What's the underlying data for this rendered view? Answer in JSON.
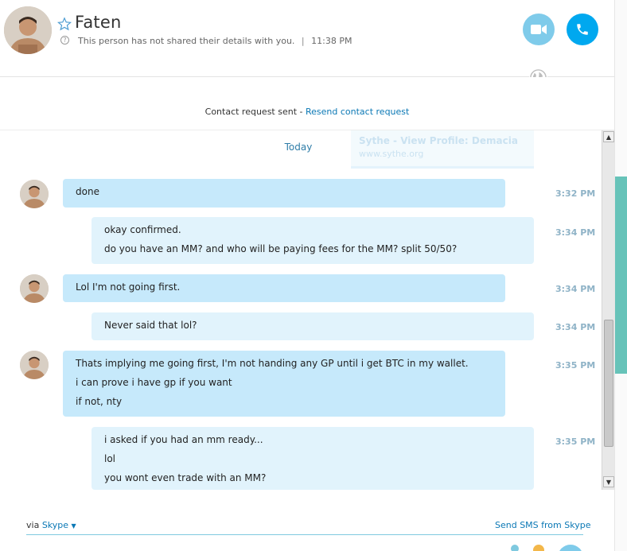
{
  "header": {
    "contact_name": "Faten",
    "subtitle": "This person has not shared their details with you.",
    "separator": "|",
    "time": "11:38 PM"
  },
  "request": {
    "text": "Contact request sent - ",
    "link": "Resend contact request"
  },
  "chat": {
    "ghost_line_1": "Sythe - View Profile: Demacia",
    "ghost_line_2": "www.sythe.org",
    "date_divider": "Today",
    "messages": [
      {
        "direction": "in",
        "time": "3:32 PM",
        "lines": [
          "done"
        ]
      },
      {
        "direction": "out",
        "time": "3:34 PM",
        "lines": [
          "okay confirmed.",
          "do you have an MM? and who will be paying fees for the MM? split 50/50?"
        ]
      },
      {
        "direction": "in",
        "time": "3:34 PM",
        "lines": [
          "Lol I'm not going first."
        ]
      },
      {
        "direction": "out",
        "time": "3:34 PM",
        "lines": [
          "Never said that lol?"
        ]
      },
      {
        "direction": "in",
        "time": "3:35 PM",
        "lines": [
          "Thats implying me going first, I'm not handing any GP until i get BTC in my wallet.",
          "i can prove i have gp if you want",
          "if not, nty"
        ]
      },
      {
        "direction": "out",
        "time": "3:35 PM",
        "lines": [
          "i asked if you had an mm ready...",
          "lol",
          "you wont even trade with an MM?"
        ]
      }
    ]
  },
  "footer": {
    "via_label": "via",
    "via_service": "Skype",
    "sms_link": "Send SMS from Skype"
  },
  "colors": {
    "accent": "#00a8ef",
    "incoming_bubble": "#c6e9fb",
    "outgoing_bubble": "#e1f3fc",
    "teal": "#67c3b9"
  }
}
